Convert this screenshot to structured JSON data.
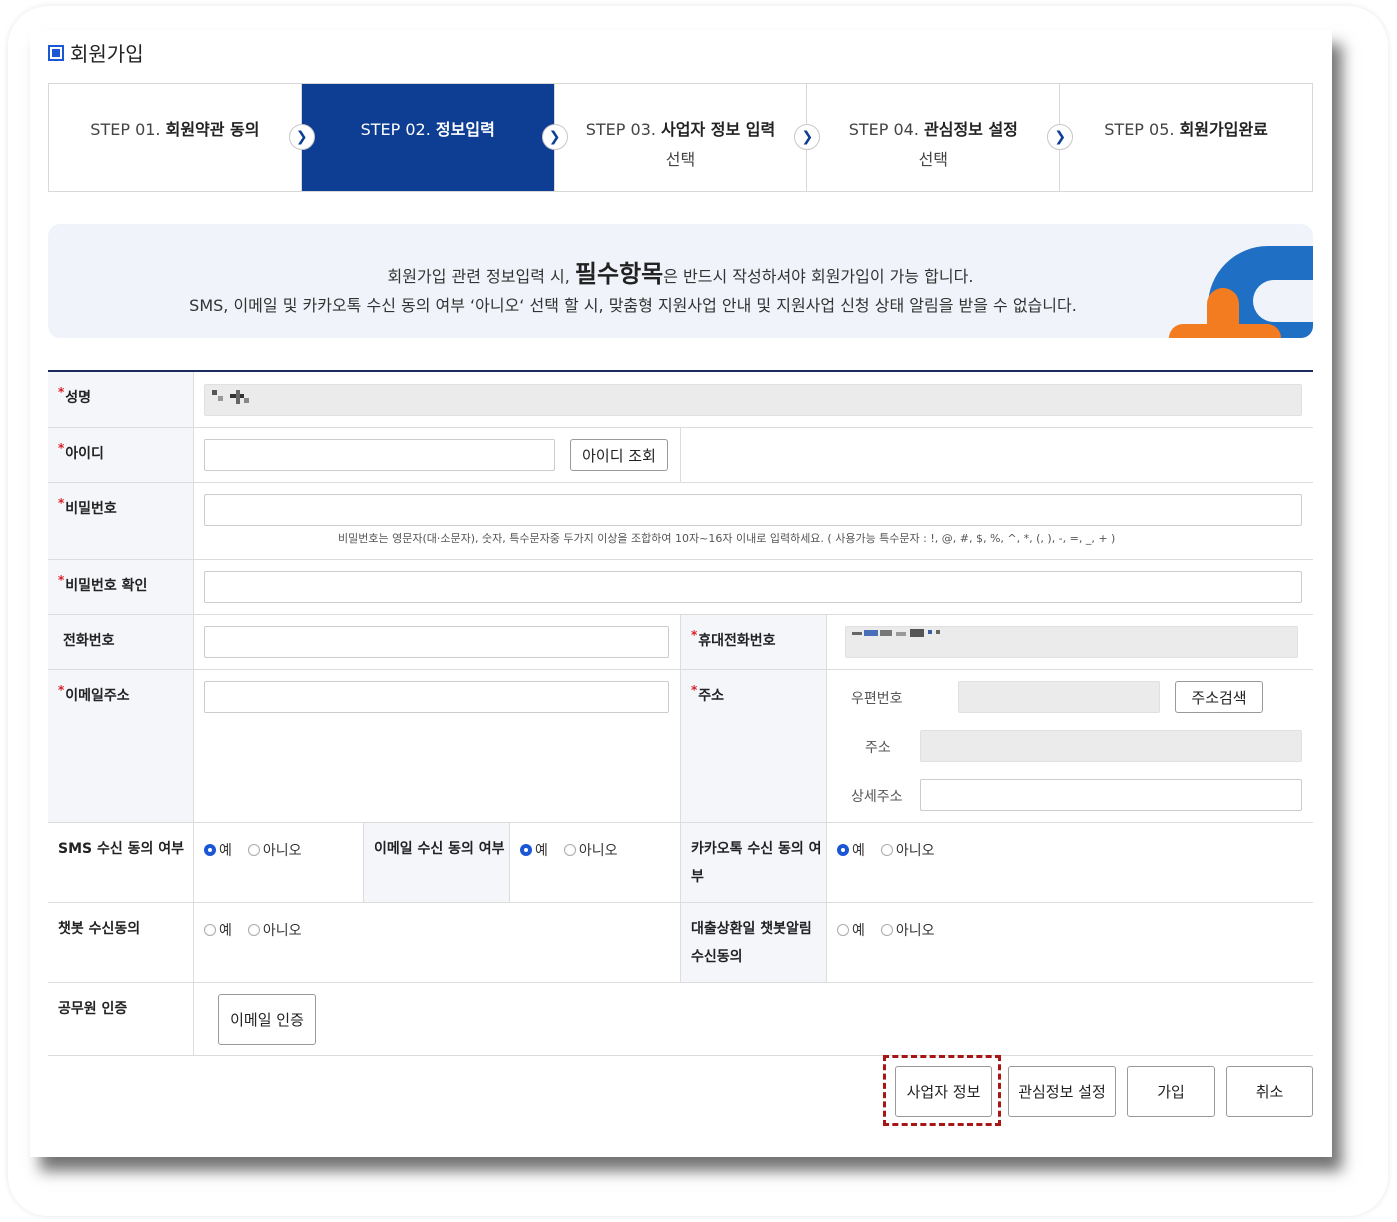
{
  "page": {
    "title": "회원가입"
  },
  "steps": [
    {
      "num": "STEP 01.",
      "name": "회원약관 동의",
      "sub": "",
      "active": false
    },
    {
      "num": "STEP 02.",
      "name": "정보입력",
      "sub": "",
      "active": true
    },
    {
      "num": "STEP 03.",
      "name": "사업자 정보 입력",
      "sub": "선택",
      "active": false
    },
    {
      "num": "STEP 04.",
      "name": "관심정보 설정",
      "sub": "선택",
      "active": false
    },
    {
      "num": "STEP 05.",
      "name": "회원가입완료",
      "sub": "",
      "active": false
    }
  ],
  "notice": {
    "line1_pre": "회원가입 관련 정보입력 시, ",
    "line1_emph": "필수항목",
    "line1_post": "은 반드시 작성하셔야 회원가입이 가능 합니다.",
    "line2": "SMS, 이메일 및 카카오톡 수신 동의 여부 ‘아니오‘ 선택 할 시, 맞춤형 지원사업 안내 및 지원사업 신청 상태 알림을 받을 수 없습니다."
  },
  "form": {
    "required_mark": "*",
    "name_label": "성명",
    "id_label": "아이디",
    "id_check_button": "아이디 조회",
    "password_label": "비밀번호",
    "password_hint": "비밀번호는 영문자(대·소문자), 숫자, 특수문자중 두가지 이상을 조합하여 10자~16자 이내로 입력하세요. ( 사용가능 특수문자 : !, @, #, $, %, ^, *, (, ), -, =, _, + )",
    "password_confirm_label": "비밀번호 확인",
    "phone_label": "전화번호",
    "mobile_label": "휴대전화번호",
    "email_label": "이메일주소",
    "address_label": "주소",
    "zipcode_label": "우편번호",
    "address_search_button": "주소검색",
    "address_field_label": "주소",
    "address_detail_label": "상세주소",
    "sms_label": "SMS 수신 동의 여부",
    "email_consent_label": "이메일 수신 동의 여부",
    "kakao_label": "카카오톡 수신 동의 여부",
    "chatbot_label": "챗봇 수신동의",
    "loan_chatbot_label": "대출상환일 챗봇알림 수신동의",
    "yes": "예",
    "no": "아니오",
    "sms_value": "예",
    "email_consent_value": "예",
    "kakao_value": "예",
    "chatbot_value": "",
    "loan_chatbot_value": "",
    "official_label": "공무원 인증",
    "email_verify_button": "이메일 인증"
  },
  "actions": {
    "business_info": "사업자 정보",
    "interest_settings": "관심정보 설정",
    "join": "가입",
    "cancel": "취소"
  },
  "colors": {
    "active_step": "#0e3d94",
    "required": "#d91f26",
    "highlight_border": "#a81515",
    "radio_on": "#1a56d6"
  }
}
